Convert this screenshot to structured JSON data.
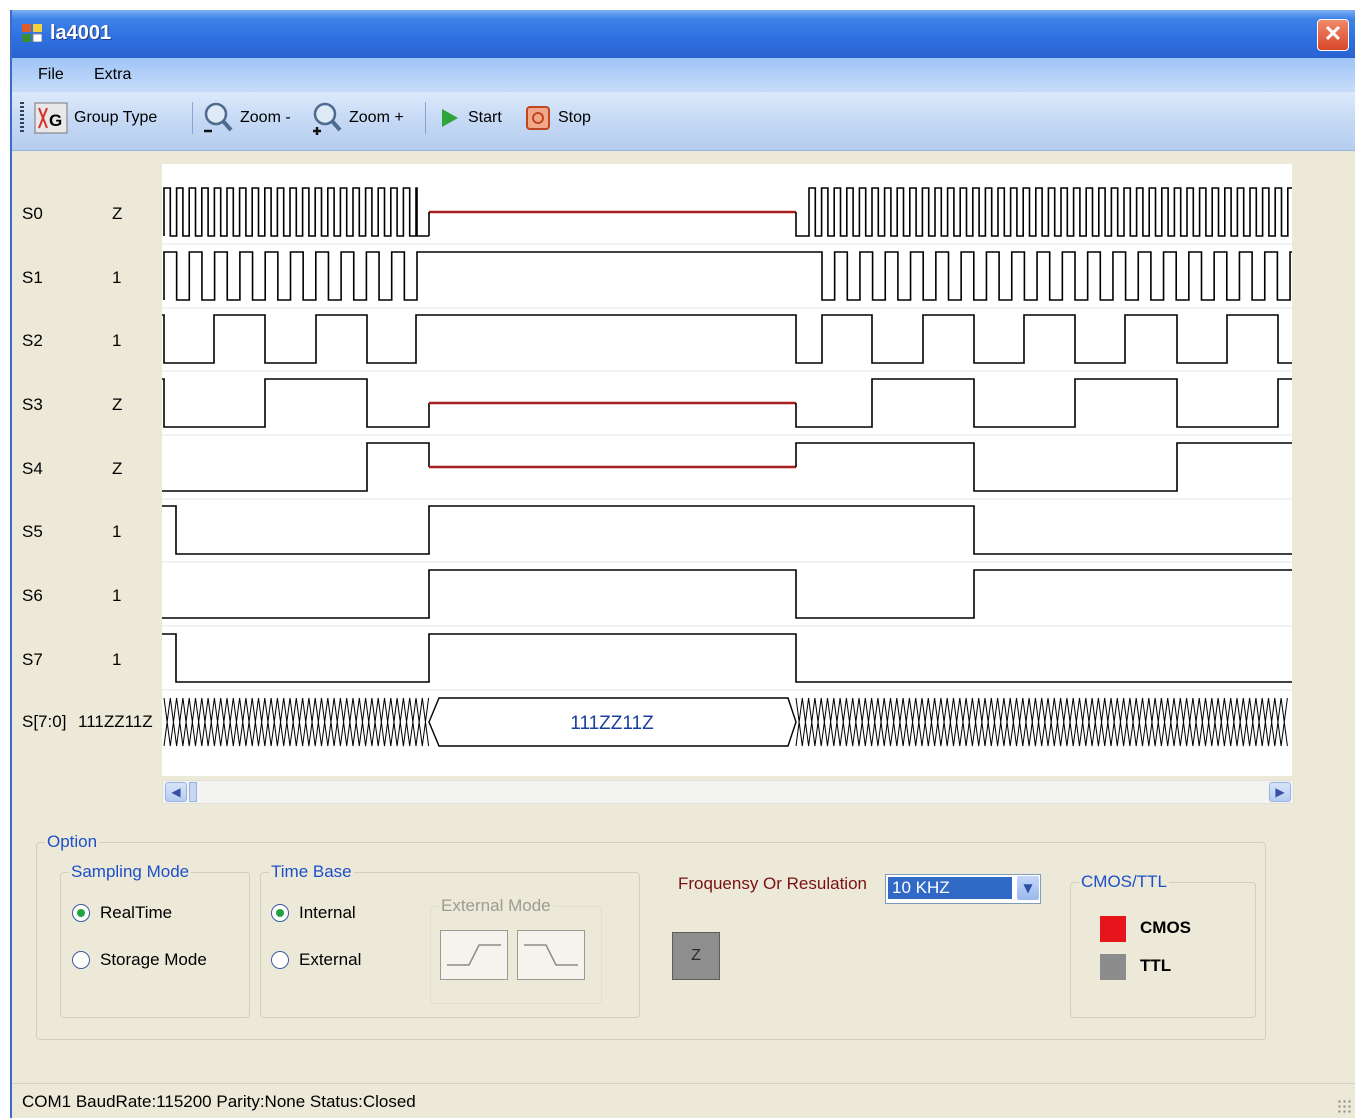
{
  "window": {
    "title": "la4001",
    "close_glyph": "✕"
  },
  "menu": {
    "items": [
      "File",
      "Extra"
    ]
  },
  "toolbar": {
    "group_type": "Group Type",
    "zoom_out": "Zoom -",
    "zoom_in": "Zoom +",
    "start": "Start",
    "stop": "Stop"
  },
  "signals": [
    {
      "name": "S0",
      "value": "Z"
    },
    {
      "name": "S1",
      "value": "1"
    },
    {
      "name": "S2",
      "value": "1"
    },
    {
      "name": "S3",
      "value": "Z"
    },
    {
      "name": "S4",
      "value": "Z"
    },
    {
      "name": "S5",
      "value": "1"
    },
    {
      "name": "S6",
      "value": "1"
    },
    {
      "name": "S7",
      "value": "1"
    }
  ],
  "bus": {
    "name": "S[7:0]",
    "value": "111ZZ11Z",
    "segment_label": "111ZZ11Z"
  },
  "options": {
    "legend": "Option",
    "sampling_mode": {
      "legend": "Sampling Mode",
      "realtime": "RealTime",
      "storage": "Storage Mode",
      "selected": "RealTime"
    },
    "time_base": {
      "legend": "Time Base",
      "internal": "Internal",
      "external": "External",
      "selected": "Internal"
    },
    "external_mode": {
      "legend": "External Mode"
    },
    "z_button": "Z",
    "frequency": {
      "label": "Froquensy Or Resulation",
      "value": "10   KHZ"
    },
    "cmos_ttl": {
      "legend": "CMOS/TTL",
      "cmos": "CMOS",
      "ttl": "TTL",
      "cmos_color": "#e8141b",
      "ttl_color": "#8c8c8c"
    }
  },
  "status": {
    "text": "COM1 BaudRate:115200 Parity:None Status:Closed"
  },
  "colors": {
    "z_state_line": "#a3201d",
    "bus_text": "#1a3f9c",
    "legend_text": "#1c4fc9"
  }
}
